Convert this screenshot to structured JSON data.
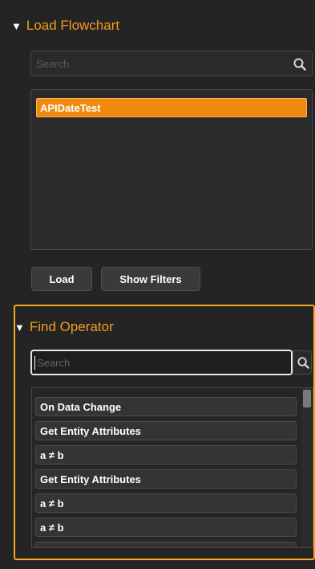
{
  "load_section": {
    "title": "Load Flowchart",
    "search_placeholder": "Search",
    "items": [
      "APIDateTest"
    ],
    "load_button": "Load",
    "show_filters_button": "Show Filters"
  },
  "find_section": {
    "title": "Find Operator",
    "search_placeholder": "Search",
    "items": [
      "On Data Change",
      "Get Entity Attributes",
      "a ≠ b",
      "Get Entity Attributes",
      "a ≠ b",
      "a ≠ b"
    ]
  },
  "colors": {
    "accent": "#f59a1b",
    "selected": "#f08a0f",
    "focus_frame": "#f5a623",
    "background": "#242424"
  },
  "icons": {
    "section_toggle": "triangle-down-icon",
    "search": "search-icon"
  }
}
